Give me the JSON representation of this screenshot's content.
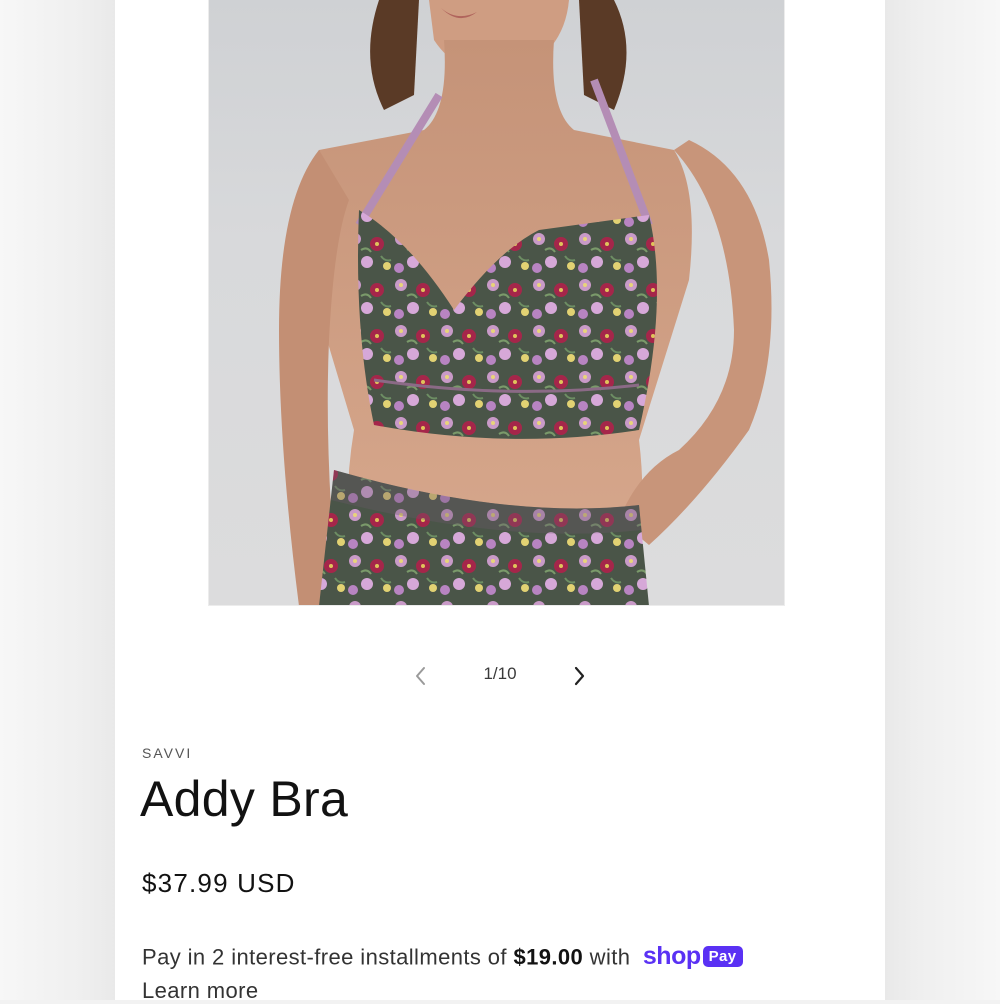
{
  "product": {
    "vendor": "SAVVI",
    "title": "Addy Bra",
    "price": "$37.99 USD"
  },
  "gallery": {
    "counter": "1/10",
    "prev_icon": "chevron-left-icon",
    "next_icon": "chevron-right-icon"
  },
  "installments": {
    "prefix": "Pay in 2 interest-free installments of",
    "amount": "$19.00",
    "suffix": "with",
    "brand_word": "shop",
    "brand_badge": "Pay",
    "learn_more": "Learn more"
  },
  "colors": {
    "accent": "#5a31f4",
    "text": "#121212"
  }
}
